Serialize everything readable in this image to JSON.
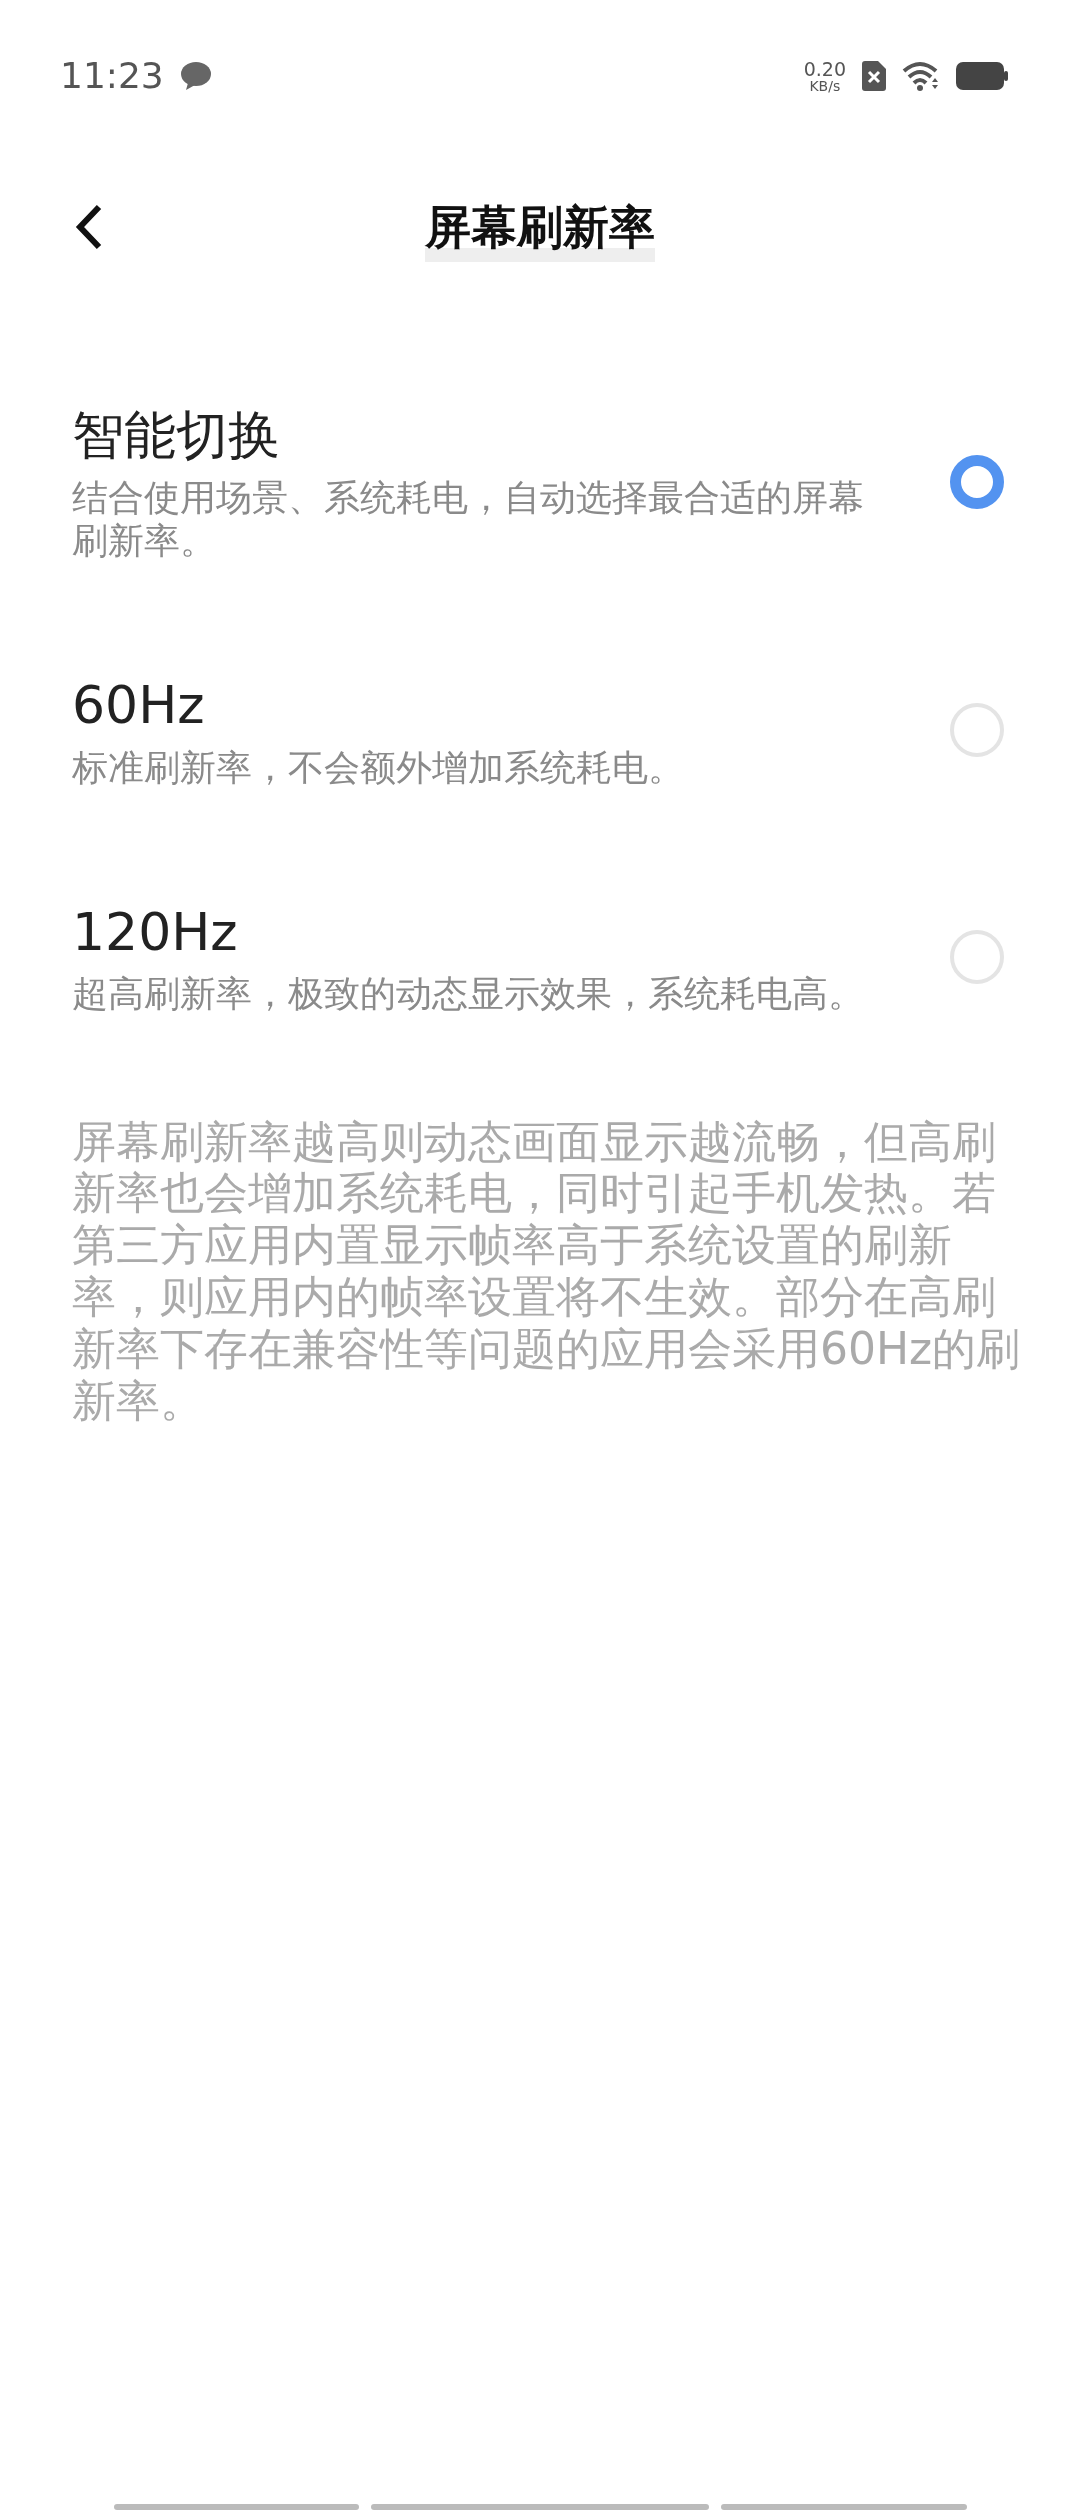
{
  "status_bar": {
    "time": "11:23",
    "speed_value": "0.20",
    "speed_unit": "KB/s"
  },
  "header": {
    "title": "屏幕刷新率"
  },
  "options": [
    {
      "title": "智能切换",
      "description": "结合使用场景、系统耗电，自动选择最合适的屏幕刷新率。",
      "selected": true
    },
    {
      "title": "60Hz",
      "description": "标准刷新率，不会额外增加系统耗电。",
      "selected": false
    },
    {
      "title": "120Hz",
      "description": "超高刷新率，极致的动态显示效果，系统耗电高。",
      "selected": false
    }
  ],
  "note": "屏幕刷新率越高则动态画面显示越流畅，但高刷新率也会增加系统耗电，同时引起手机发热。若第三方应用内置显示帧率高于系统设置的刷新率，则应用内的帧率设置将不生效。部分在高刷新率下存在兼容性等问题的应用会采用60Hz的刷新率。"
}
